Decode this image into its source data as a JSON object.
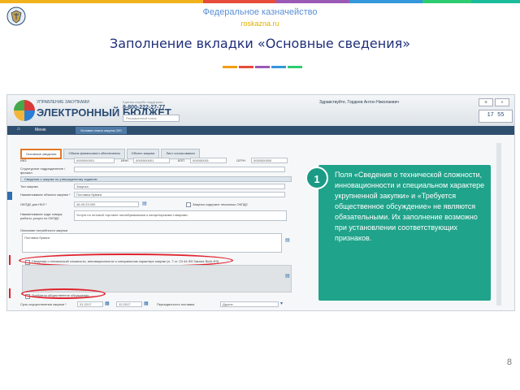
{
  "header": {
    "title": "Федеральное казначейство",
    "site": "roskazna.ru"
  },
  "slide": {
    "title": "Заполнение вкладки «Основные сведения»",
    "page_number": "8"
  },
  "colors": {
    "strip": [
      "#f2b21d",
      "#e74c3c",
      "#9b59b6",
      "#3498db",
      "#2ecc71",
      "#1abc9c"
    ],
    "accent": [
      "#f39c12",
      "#e74c3c",
      "#9b59b6",
      "#3498db",
      "#2ecc71"
    ],
    "callout": "#1fa38a",
    "highlight": "#e0232e"
  },
  "app": {
    "brand_small": "УПРАВЛЕНИЕ ЗАКУПКАМИ",
    "brand_big": "ЭЛЕКТРОННЫЙ БЮДЖЕТ",
    "help_label": "Единая служба поддержки",
    "help_phone": "8-800-222-27-77",
    "search_placeholder": "Расширенный поиск",
    "user_greeting": "Здравствуйте, Гордеев Антон Николаевич",
    "clock": "17 55",
    "nav_menu": "Меню",
    "nav_tab": "Условия плана закупок 200",
    "tabs": [
      "Основные сведения",
      "Объем финансового обеспечения",
      "Объект закупки",
      "Лист согласования"
    ],
    "fields": {
      "ikz_label": "ИКЗ",
      "ikz_value": "0000000001",
      "inn_label": "ИНН",
      "inn_value": "0000000001",
      "kpp_label": "КПП",
      "kpp_value": "000000001",
      "ogrn_label": "ОГРН",
      "ogrn_value": "0000000000",
      "unit_label": "Структурное подразделение / филиал",
      "section_title": "Сведения о закупке по утвержденному заданию",
      "type_label": "Тип закупки",
      "type_value": "Закупка",
      "object_label": "Наименование объекта закупки *",
      "object_value": "Поставка бумаги",
      "okpd_label": "ОКПД2 для НКЗ *",
      "okpd_value": "46.49.23.000",
      "okpd_check": "Закупка содержит несколько ОКПД2",
      "okpd_name_label": "Наименование кода товара, работы, услуги по ОКПД2",
      "okpd_name_value": "Услуги по оптовой торговле писчебумажными и канцелярскими товарами",
      "need_label": "Описание потребности закупки",
      "need_value": "Поставка бумаги",
      "complex_check": "Сведения о технической сложности, инновационности и специальном характере закупки (ч. 7 ст. 23 44-ФЗ Закона №44-ФЗ)",
      "discussion_check": "Требуется общественное обсуждение",
      "term_label": "Срок осуществления закупки *",
      "term_from": "01.2017",
      "term_to": "12.2017",
      "period_label": "Периодичность поставки",
      "period_value": "Другое"
    }
  },
  "callout": {
    "number": "1",
    "text": "Поля «Сведения о технической сложности, инновационности и специальном характере укрупненной закупки» и «Требуется общественное обсуждение» не являются обязательными. Их заполнение возможно при установлении соответствующих признаков."
  }
}
